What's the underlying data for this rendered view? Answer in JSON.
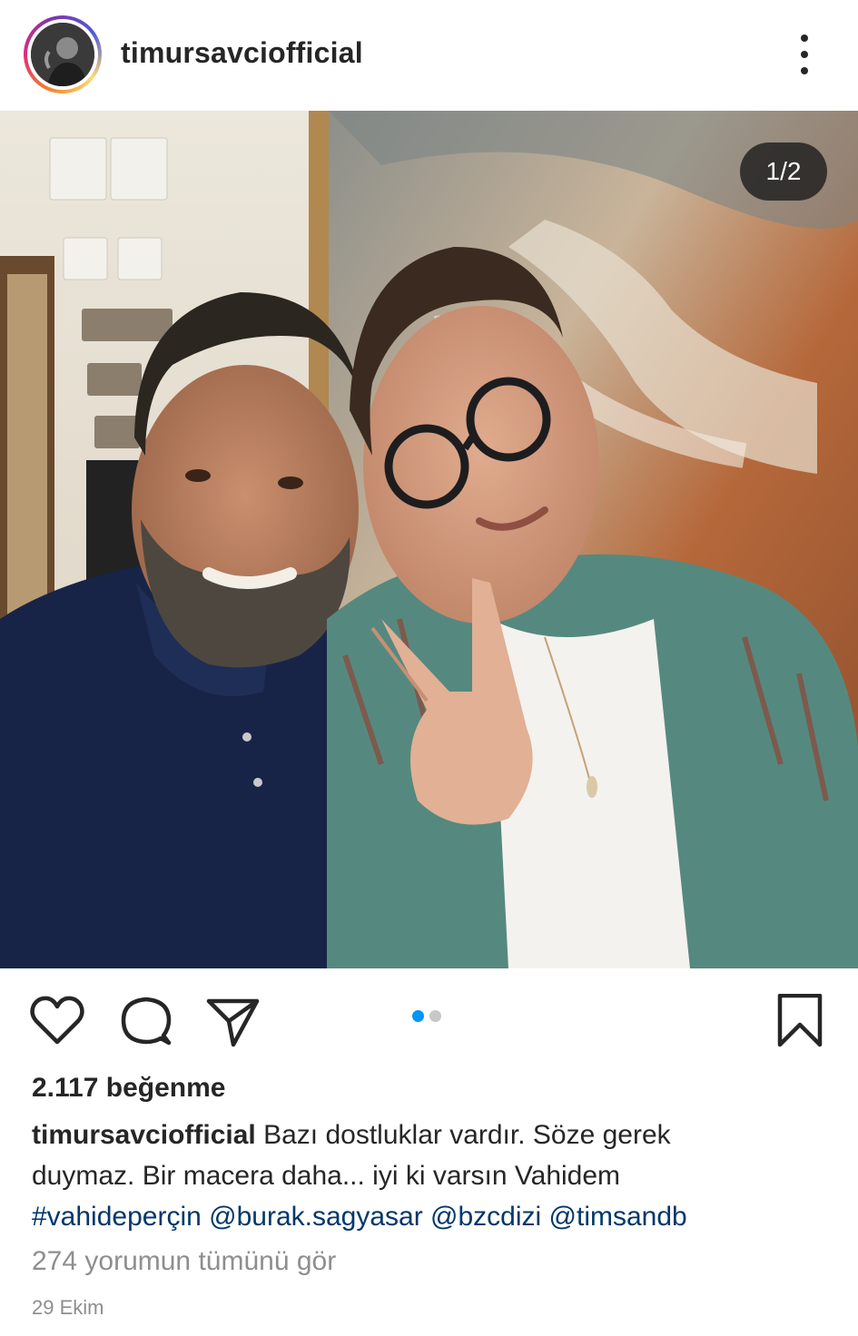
{
  "post": {
    "username": "timursavciofficial",
    "counter": "1/2",
    "likes": "2.117 beğenme",
    "caption": {
      "username": "timursavciofficial",
      "text_line1": "Bazı dostluklar vardır. Söze gerek",
      "text_line2": "duymaz.  Bir macera daha... iyi ki varsın Vahidem",
      "hashtag": "#vahideperçin",
      "mention1": "@burak.sagyasar",
      "mention2": "@bzcdizi",
      "mention3": "@timsandb"
    },
    "view_comments": "274 yorumun tümünü gör",
    "date": "29 Ekim"
  },
  "carousel": {
    "total": 2,
    "active_index": 0
  },
  "colors": {
    "accent": "#0095f6",
    "link": "#00376b",
    "muted": "#8e8e8e",
    "text": "#262626"
  },
  "icons": [
    "more-options-icon",
    "heart-icon",
    "comment-icon",
    "share-icon",
    "bookmark-icon"
  ]
}
